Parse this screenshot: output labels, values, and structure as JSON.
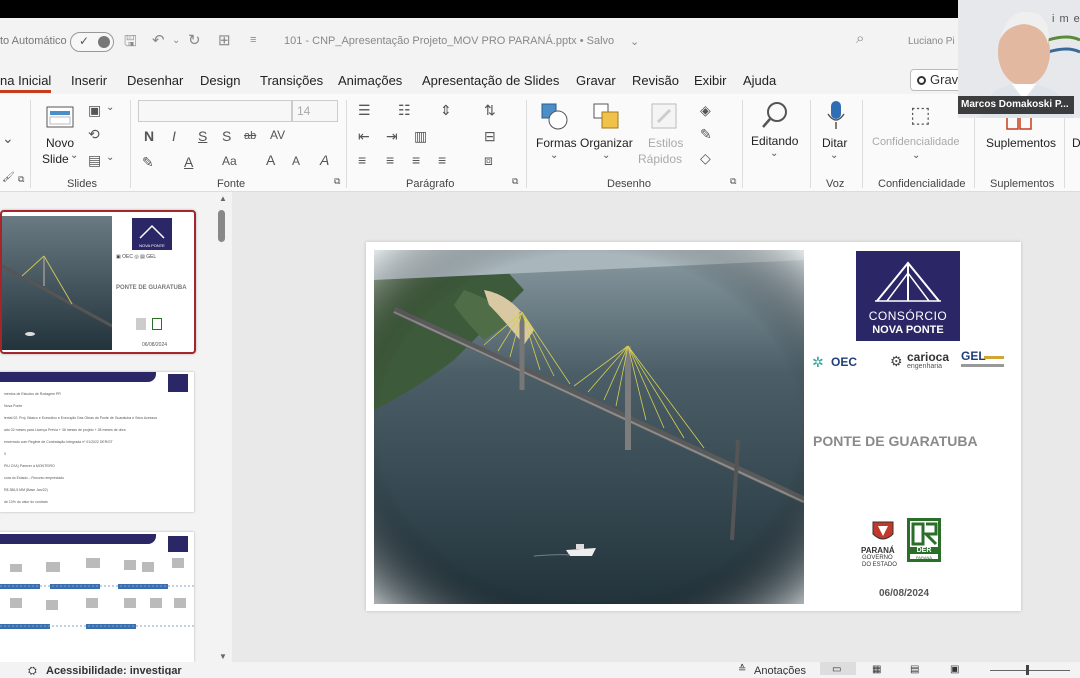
{
  "titlebar": {
    "autosave_label": "to Automático",
    "document_title": "101 - CNP_Apresentação Projeto_MOV PRO PARANÁ.pptx • Salvo",
    "user": "Luciano Pi"
  },
  "menu": {
    "items": [
      "na Inicial",
      "Inserir",
      "Desenhar",
      "Design",
      "Transições",
      "Animações",
      "Apresentação de Slides",
      "Gravar",
      "Revisão",
      "Exibir",
      "Ajuda"
    ],
    "record_button": "Grav"
  },
  "ribbon": {
    "groups": {
      "slides": "Slides",
      "fonte": "Fonte",
      "paragrafo": "Parágrafo",
      "desenho": "Desenho",
      "voz": "Voz",
      "confidencialidade": "Confidencialidade",
      "suplementos": "Suplementos"
    },
    "buttons": {
      "novo_slide": "Novo",
      "novo_slide_2": "Slide",
      "font_size": "14",
      "formas": "Formas",
      "organizar": "Organizar",
      "estilos": "Estilos",
      "rapidos": "Rápidos",
      "editando": "Editando",
      "ditar": "Ditar",
      "confidencialidade": "Confidencialidade",
      "suplementos": "Suplementos",
      "d": "D"
    },
    "format_letters": [
      "N",
      "I",
      "S",
      "S",
      "ab",
      "AV",
      "A",
      "Aa",
      "A",
      "A",
      "A"
    ]
  },
  "thumbnails": {
    "slide1_title": "PONTE DE GUARATUBA",
    "slide1_logo": "NOVA PONTE",
    "slide1_date": "06/08/2024",
    "slide2_lines": [
      "mentos de Estudos de Rodagem PR",
      "Nova Ponte",
      "lental 02, Proj. Básico e Executivo e Execução Das Obras da Ponte de Guaratuba e Seus Acessos",
      "ado 02 meses para Licença Prévia + 36 meses de projeto + 28 meses de obra",
      "encerrado com Regime de Contratação Integrada nº 01/2022 DER/ST",
      "0",
      "PIU ZXA) Parecer à MONTEIRO",
      "cura do Estado – Recurso emprestado",
      "R$ 386,5 MM (Base Jan/22)",
      "de 10% do valor do contrato"
    ]
  },
  "slide": {
    "logo_line1": "CONSÓRCIO",
    "logo_line2": "NOVA PONTE",
    "partner1": "OEC",
    "partner2": "carioca",
    "partner2_sub": "engenharia",
    "partner3": "GEL",
    "title": "PONTE DE GUARATUBA",
    "gov_label1": "PARANÁ",
    "gov_label2": "GOVERNO",
    "gov_label3": "DO ESTADO",
    "der_label": "DER",
    "der_sub": "PARANÁ",
    "date": "06/08/2024"
  },
  "status": {
    "accessibility": "Acessibilidade: investigar",
    "notes": "Anotações"
  },
  "webcam": {
    "name": "Marcos Domakoski P...",
    "bg_text": "ime"
  }
}
